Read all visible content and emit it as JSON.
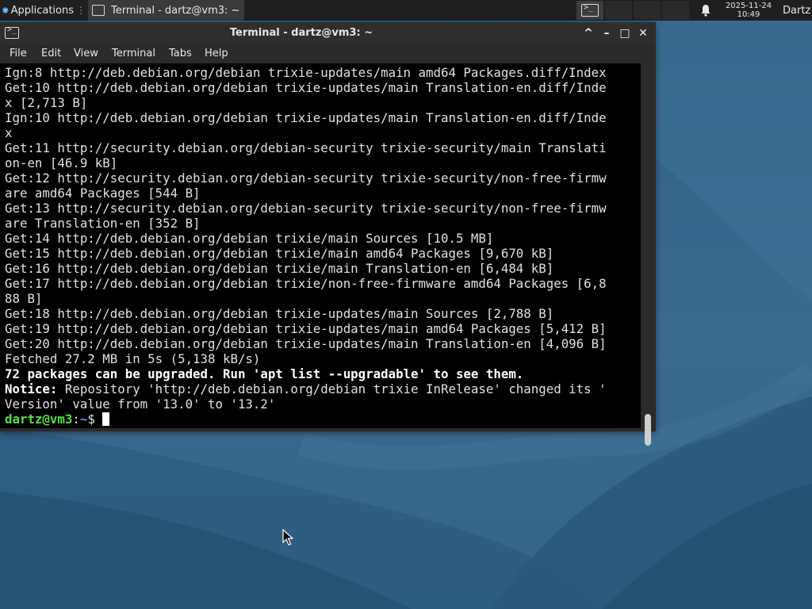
{
  "panel": {
    "apps_label": "Applications",
    "apps_separator": "⋮",
    "task_label": "Terminal - dartz@vm3: ~",
    "workspace_icon": "terminal-icon",
    "bell_icon": "bell-icon",
    "clock_date": "2025-11-24",
    "clock_time": "10:49",
    "user_label": "Dartz"
  },
  "window": {
    "title": "Terminal - dartz@vm3: ~",
    "buttons": {
      "shade": "^",
      "minimize": "–",
      "maximize": "□",
      "close": "✕"
    }
  },
  "menubar": {
    "file": "File",
    "edit": "Edit",
    "view": "View",
    "terminal": "Terminal",
    "tabs": "Tabs",
    "help": "Help"
  },
  "terminal": {
    "lines": [
      "Ign:8 http://deb.debian.org/debian trixie-updates/main amd64 Packages.diff/Index",
      "Get:10 http://deb.debian.org/debian trixie-updates/main Translation-en.diff/Inde",
      "x [2,713 B]",
      "Ign:10 http://deb.debian.org/debian trixie-updates/main Translation-en.diff/Inde",
      "x",
      "Get:11 http://security.debian.org/debian-security trixie-security/main Translati",
      "on-en [46.9 kB]",
      "Get:12 http://security.debian.org/debian-security trixie-security/non-free-firmw",
      "are amd64 Packages [544 B]",
      "Get:13 http://security.debian.org/debian-security trixie-security/non-free-firmw",
      "are Translation-en [352 B]",
      "Get:14 http://deb.debian.org/debian trixie/main Sources [10.5 MB]",
      "Get:15 http://deb.debian.org/debian trixie/main amd64 Packages [9,670 kB]",
      "Get:16 http://deb.debian.org/debian trixie/main Translation-en [6,484 kB]",
      "Get:17 http://deb.debian.org/debian trixie/non-free-firmware amd64 Packages [6,8",
      "88 B]",
      "Get:18 http://deb.debian.org/debian trixie-updates/main Sources [2,788 B]",
      "Get:19 http://deb.debian.org/debian trixie-updates/main amd64 Packages [5,412 B]",
      "Get:20 http://deb.debian.org/debian trixie-updates/main Translation-en [4,096 B]",
      "Fetched 27.2 MB in 5s (5,138 kB/s)"
    ],
    "upgrade_notice": "72 packages can be upgraded. Run 'apt list --upgradable' to see them.",
    "notice_label": "Notice:",
    "notice_text_1": " Repository 'http://deb.debian.org/debian trixie InRelease' changed its '",
    "notice_text_2": "Version' value from '13.0' to '13.2'",
    "prompt_user": "dartz@vm3",
    "prompt_sep": ":",
    "prompt_path": "~",
    "prompt_symbol": "$ "
  },
  "colors": {
    "desktop": "#3a6b8f",
    "panel": "#1f1f1f",
    "terminal_bg": "#000000",
    "prompt_user": "#55e04a",
    "prompt_path": "#6c8ef5"
  }
}
